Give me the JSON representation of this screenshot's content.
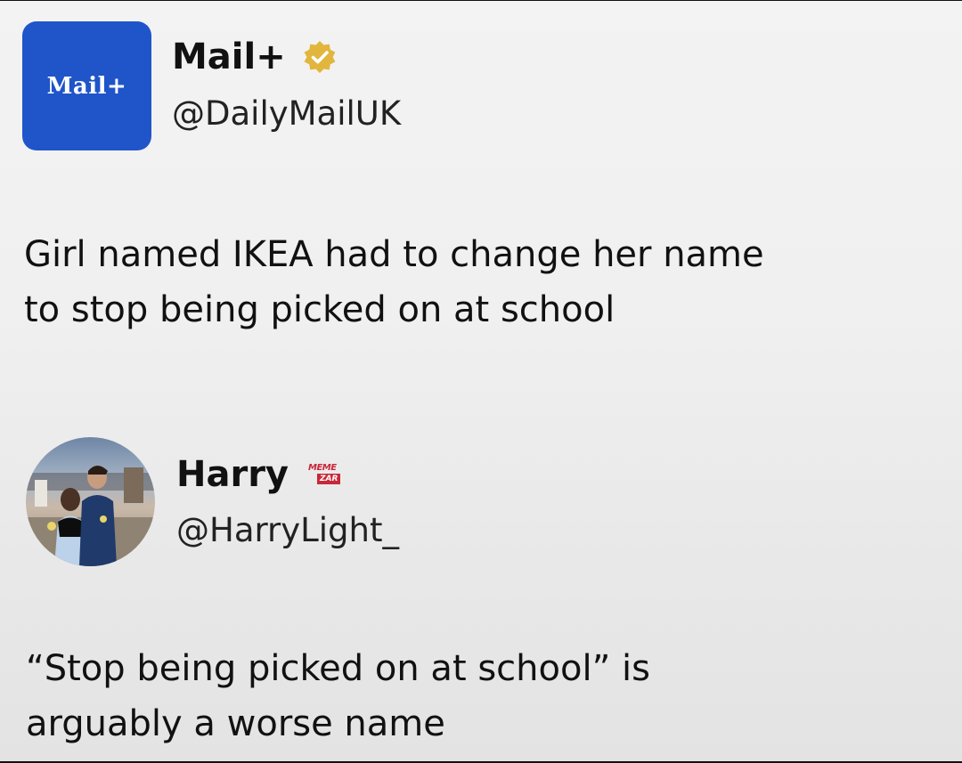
{
  "tweet1": {
    "avatar_text": "Mail+",
    "display_name": "Mail+",
    "handle": "@DailyMailUK",
    "verified": true,
    "text_lines": [
      "Girl named IKEA had to change her name",
      "to stop being picked on at school"
    ]
  },
  "tweet2": {
    "display_name": "Harry",
    "handle": "@HarryLight_",
    "watermark": [
      "MEME",
      "ZAR"
    ],
    "text_lines": [
      "“Stop being picked on at school” is",
      "arguably a worse name"
    ]
  },
  "colors": {
    "mail_brand": "#1f55c9",
    "verified_badge": "#e2b53c",
    "watermark": "#c8283a"
  },
  "icons": {
    "verified": "verified-badge-icon"
  }
}
